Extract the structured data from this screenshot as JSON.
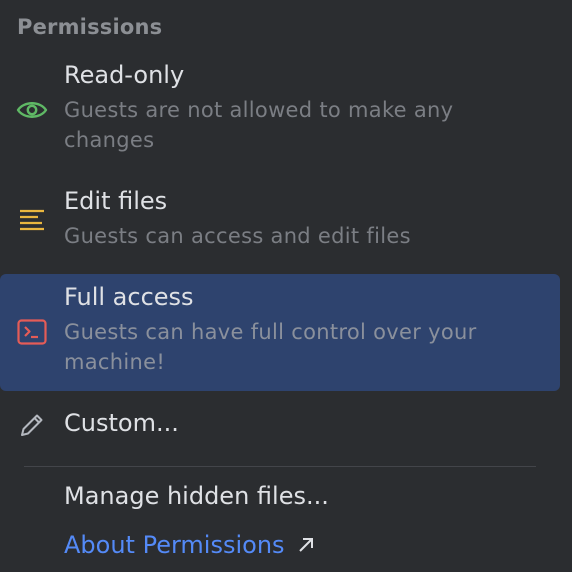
{
  "menu": {
    "header": "Permissions",
    "options": [
      {
        "title": "Read-only",
        "description": "Guests are not allowed to make any changes",
        "icon": "eye-icon",
        "color": "#5fb865"
      },
      {
        "title": "Edit files",
        "description": "Guests can access and edit files",
        "icon": "lines-icon",
        "color": "#e9b63f"
      },
      {
        "title": "Full access",
        "description": "Guests can have full control over your machine!",
        "icon": "terminal-icon",
        "color": "#e55c57",
        "selected": true
      },
      {
        "title": "Custom...",
        "icon": "pencil-icon"
      }
    ],
    "manage_label": "Manage hidden files...",
    "about_label": "About Permissions"
  }
}
